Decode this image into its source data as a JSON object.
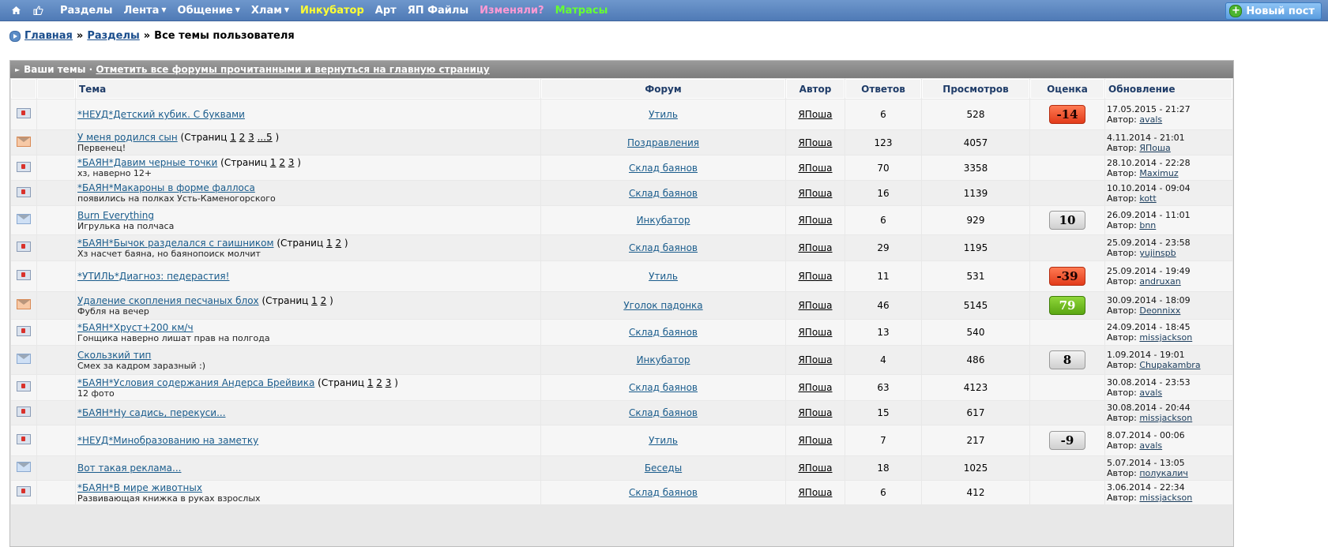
{
  "nav": {
    "items": [
      {
        "label": "Разделы",
        "style": "white",
        "caret": false
      },
      {
        "label": "Лента",
        "style": "white",
        "caret": true
      },
      {
        "label": "Общение",
        "style": "white",
        "caret": true
      },
      {
        "label": "Хлам",
        "style": "white",
        "caret": true
      },
      {
        "label": "Инкубатор",
        "style": "yellow",
        "caret": false
      },
      {
        "label": "Арт",
        "style": "white",
        "caret": false
      },
      {
        "label": "ЯП Файлы",
        "style": "white",
        "caret": false
      },
      {
        "label": "Изменяли?",
        "style": "pink",
        "caret": false
      },
      {
        "label": "Матрасы",
        "style": "green",
        "caret": false
      }
    ],
    "new_post": "Новый пост"
  },
  "breadcrumb": {
    "home": "Главная",
    "sections": "Разделы",
    "current": "Все темы пользователя",
    "sep": "»"
  },
  "box": {
    "title": "Ваши темы",
    "dash": " · ",
    "mark_read": "Отметить все форумы прочитанными и вернуться на главную страницу"
  },
  "columns": {
    "topic": "Тема",
    "forum": "Форум",
    "author": "Автор",
    "replies": "Ответов",
    "views": "Просмотров",
    "rating": "Оценка",
    "update": "Обновление"
  },
  "by_label": "Автор:",
  "pages_label": "Страниц",
  "rows": [
    {
      "icon": "hot",
      "title": "*НЕУД*Детский кубик. С буквами",
      "pages": [],
      "sub": "",
      "forum": "Утиль",
      "author": "ЯПоша",
      "replies": "6",
      "views": "528",
      "rating": "-14",
      "rating_type": "neg",
      "date": "17.05.2015 - 21:27",
      "by": "avals"
    },
    {
      "icon": "env-or",
      "title": "У меня родился сын",
      "pages": [
        "1",
        "2",
        "3",
        "...5"
      ],
      "sub": "Первенец!",
      "forum": "Поздравления",
      "author": "ЯПоша",
      "replies": "123",
      "views": "4057",
      "rating": "",
      "rating_type": "",
      "date": "4.11.2014 - 21:01",
      "by": "ЯПоша"
    },
    {
      "icon": "hot",
      "title": "*БАЯН*Давим черные точки",
      "pages": [
        "1",
        "2",
        "3"
      ],
      "sub": "хз, наверно 12+",
      "forum": "Склад баянов",
      "author": "ЯПоша",
      "replies": "70",
      "views": "3358",
      "rating": "",
      "rating_type": "",
      "date": "28.10.2014 - 22:28",
      "by": "Maximuz"
    },
    {
      "icon": "hot",
      "title": "*БАЯН*Макароны в форме фаллоса",
      "pages": [],
      "sub": "появились на полках Усть-Каменогорского",
      "forum": "Склад баянов",
      "author": "ЯПоша",
      "replies": "16",
      "views": "1139",
      "rating": "",
      "rating_type": "",
      "date": "10.10.2014 - 09:04",
      "by": "kott"
    },
    {
      "icon": "env-bl",
      "title": "Burn Everything",
      "pages": [],
      "sub": "Игрулька на полчаса",
      "forum": "Инкубатор",
      "author": "ЯПоша",
      "replies": "6",
      "views": "929",
      "rating": "10",
      "rating_type": "neu",
      "date": "26.09.2014 - 11:01",
      "by": "bnn"
    },
    {
      "icon": "hot",
      "title": "*БАЯН*Бычок разделался с гаишником",
      "pages": [
        "1",
        "2"
      ],
      "sub": "Хз насчет баяна, но баянопоиск молчит",
      "forum": "Склад баянов",
      "author": "ЯПоша",
      "replies": "29",
      "views": "1195",
      "rating": "",
      "rating_type": "",
      "date": "25.09.2014 - 23:58",
      "by": "yujinspb"
    },
    {
      "icon": "hot",
      "title": "*УТИЛЬ*Диагноз: педерастия!",
      "pages": [],
      "sub": "",
      "forum": "Утиль",
      "author": "ЯПоша",
      "replies": "11",
      "views": "531",
      "rating": "-39",
      "rating_type": "neg",
      "date": "25.09.2014 - 19:49",
      "by": "andruxan"
    },
    {
      "icon": "env-or",
      "title": "Удаление скопления песчаных блох",
      "pages": [
        "1",
        "2"
      ],
      "sub": "Фубля на вечер",
      "forum": "Уголок падонка",
      "author": "ЯПоша",
      "replies": "46",
      "views": "5145",
      "rating": "79",
      "rating_type": "pos",
      "date": "30.09.2014 - 18:09",
      "by": "Deonnixx"
    },
    {
      "icon": "hot",
      "title": "*БАЯН*Хруст+200 км/ч",
      "pages": [],
      "sub": "Гонщика наверно лишат прав на полгода",
      "forum": "Склад баянов",
      "author": "ЯПоша",
      "replies": "13",
      "views": "540",
      "rating": "",
      "rating_type": "",
      "date": "24.09.2014 - 18:45",
      "by": "missjackson"
    },
    {
      "icon": "env-bl",
      "title": "Скользкий тип",
      "pages": [],
      "sub": "Смех за кадром заразный :)",
      "forum": "Инкубатор",
      "author": "ЯПоша",
      "replies": "4",
      "views": "486",
      "rating": "8",
      "rating_type": "neu",
      "date": "1.09.2014 - 19:01",
      "by": "Chupakambra"
    },
    {
      "icon": "hot",
      "title": "*БАЯН*Условия содержания Андерса Брейвика",
      "pages": [
        "1",
        "2",
        "3"
      ],
      "sub": "12 фото",
      "forum": "Склад баянов",
      "author": "ЯПоша",
      "replies": "63",
      "views": "4123",
      "rating": "",
      "rating_type": "",
      "date": "30.08.2014 - 23:53",
      "by": "avals"
    },
    {
      "icon": "hot",
      "title": "*БАЯН*Ну садись, перекуси...",
      "pages": [],
      "sub": "",
      "forum": "Склад баянов",
      "author": "ЯПоша",
      "replies": "15",
      "views": "617",
      "rating": "",
      "rating_type": "",
      "date": "30.08.2014 - 20:44",
      "by": "missjackson"
    },
    {
      "icon": "hot",
      "title": "*НЕУД*Минобразованию на заметку",
      "pages": [],
      "sub": "",
      "forum": "Утиль",
      "author": "ЯПоша",
      "replies": "7",
      "views": "217",
      "rating": "-9",
      "rating_type": "neu",
      "date": "8.07.2014 - 00:06",
      "by": "avals"
    },
    {
      "icon": "env-bl",
      "title": "Вот такая реклама...",
      "pages": [],
      "sub": "",
      "forum": "Беседы",
      "author": "ЯПоша",
      "replies": "18",
      "views": "1025",
      "rating": "",
      "rating_type": "",
      "date": "5.07.2014 - 13:05",
      "by": "полукалич"
    },
    {
      "icon": "hot",
      "title": "*БАЯН*В мире животных",
      "pages": [],
      "sub": "Развивающая книжка в руках взрослых",
      "forum": "Склад баянов",
      "author": "ЯПоша",
      "replies": "6",
      "views": "412",
      "rating": "",
      "rating_type": "",
      "date": "3.06.2014 - 22:34",
      "by": "missjackson"
    }
  ]
}
